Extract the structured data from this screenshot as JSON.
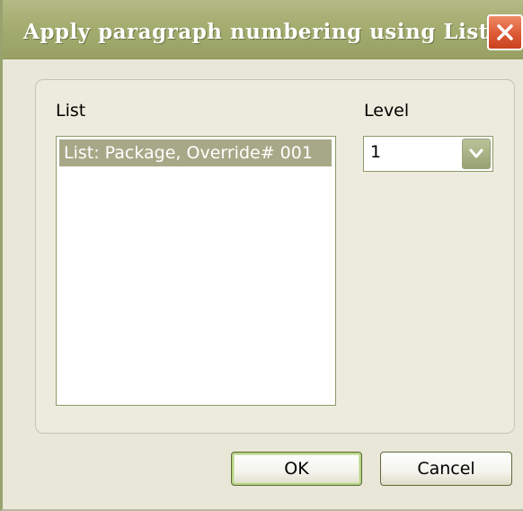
{
  "window": {
    "title": "Apply paragraph numbering using Lists"
  },
  "list_section": {
    "label": "List",
    "items": [
      {
        "label": "List: Package, Override# 001",
        "selected": true
      }
    ]
  },
  "level_section": {
    "label": "Level",
    "selected_value": "1"
  },
  "buttons": {
    "ok_label": "OK",
    "cancel_label": "Cancel"
  },
  "icons": {
    "close": "close-icon",
    "dropdown": "chevron-down-icon"
  },
  "colors": {
    "titlebar": "#a4ac70",
    "close_button": "#dd5a36",
    "selection": "#a7a887",
    "dialog_background": "#e9e7d8"
  }
}
